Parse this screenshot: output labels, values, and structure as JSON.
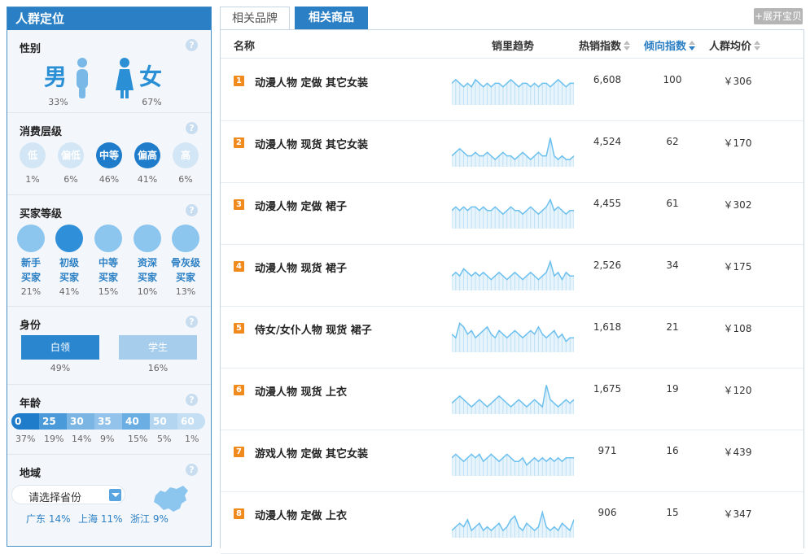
{
  "panel_title": "人群定位",
  "help_glyph": "?",
  "gender": {
    "title": "性别",
    "male_label": "男",
    "male_pct": "33%",
    "female_label": "女",
    "female_pct": "67%"
  },
  "consume": {
    "title": "消费层级",
    "levels": [
      {
        "label": "低",
        "pct": "1%",
        "dark": false
      },
      {
        "label": "偏低",
        "pct": "6%",
        "dark": false
      },
      {
        "label": "中等",
        "pct": "46%",
        "dark": true
      },
      {
        "label": "偏高",
        "pct": "41%",
        "dark": true
      },
      {
        "label": "高",
        "pct": "6%",
        "dark": false
      }
    ]
  },
  "buyer": {
    "title": "买家等级",
    "levels": [
      {
        "line1": "新手",
        "line2": "买家",
        "pct": "21%"
      },
      {
        "line1": "初级",
        "line2": "买家",
        "pct": "41%"
      },
      {
        "line1": "中等",
        "line2": "买家",
        "pct": "15%"
      },
      {
        "line1": "资深",
        "line2": "买家",
        "pct": "10%"
      },
      {
        "line1": "骨灰级",
        "line2": "买家",
        "pct": "13%"
      }
    ]
  },
  "identity": {
    "title": "身份",
    "items": [
      {
        "label": "白领",
        "pct": "49%"
      },
      {
        "label": "学生",
        "pct": "16%"
      }
    ]
  },
  "age": {
    "title": "年龄",
    "bands": [
      {
        "label": "0",
        "pct": "37%",
        "color": "#1e7ccb"
      },
      {
        "label": "25",
        "pct": "19%",
        "color": "#4a9ad9"
      },
      {
        "label": "30",
        "pct": "14%",
        "color": "#7ab5e4"
      },
      {
        "label": "35",
        "pct": "9%",
        "color": "#93c3ea"
      },
      {
        "label": "40",
        "pct": "15%",
        "color": "#6aaee3"
      },
      {
        "label": "50",
        "pct": "5%",
        "color": "#b3d5f0"
      },
      {
        "label": "60",
        "pct": "1%",
        "color": "#c4def3"
      }
    ]
  },
  "region": {
    "title": "地域",
    "select_placeholder": "请选择省份",
    "items": [
      "广东 14%",
      "上海 11%",
      "浙江 9%"
    ]
  },
  "tabs": {
    "brand": "相关品牌",
    "goods": "相关商品",
    "expand": "+展开宝贝"
  },
  "table": {
    "headers": {
      "name": "名称",
      "trend": "销里趋势",
      "hot": "热销指数",
      "tend": "倾向指数",
      "price": "人群均价"
    },
    "rows": [
      {
        "rank": "1",
        "name": "动漫人物 定做 其它女装",
        "hot": "6,608",
        "tend": "100",
        "price": "￥306",
        "trend": [
          6,
          7,
          6,
          5,
          6,
          5,
          7,
          6,
          5,
          6,
          5,
          6,
          6,
          5,
          6,
          7,
          6,
          5,
          6,
          6,
          5,
          6,
          5,
          6,
          6,
          5,
          6,
          7,
          6,
          5,
          6,
          6
        ]
      },
      {
        "rank": "2",
        "name": "动漫人物 现货 其它女装",
        "hot": "4,524",
        "tend": "62",
        "price": "￥170",
        "trend": [
          3,
          4,
          5,
          4,
          3,
          3,
          4,
          3,
          3,
          4,
          3,
          2,
          3,
          4,
          3,
          3,
          2,
          3,
          4,
          3,
          2,
          3,
          4,
          3,
          3,
          8,
          3,
          2,
          3,
          2,
          2,
          3
        ]
      },
      {
        "rank": "3",
        "name": "动漫人物 定做 裙子",
        "hot": "4,455",
        "tend": "61",
        "price": "￥302",
        "trend": [
          5,
          6,
          5,
          6,
          5,
          6,
          6,
          5,
          6,
          5,
          5,
          6,
          5,
          4,
          5,
          6,
          5,
          5,
          4,
          5,
          6,
          5,
          4,
          5,
          6,
          8,
          5,
          6,
          5,
          4,
          5,
          5
        ]
      },
      {
        "rank": "4",
        "name": "动漫人物 现货 裙子",
        "hot": "2,526",
        "tend": "34",
        "price": "￥175",
        "trend": [
          4,
          5,
          4,
          6,
          5,
          4,
          5,
          4,
          5,
          4,
          3,
          4,
          5,
          4,
          3,
          4,
          5,
          4,
          3,
          4,
          5,
          4,
          3,
          4,
          5,
          8,
          4,
          5,
          3,
          5,
          4,
          4
        ]
      },
      {
        "rank": "5",
        "name": "侍女/女仆人物 现货 裙子",
        "hot": "1,618",
        "tend": "21",
        "price": "￥108",
        "trend": [
          5,
          4,
          8,
          7,
          5,
          6,
          4,
          5,
          6,
          7,
          5,
          4,
          6,
          5,
          4,
          5,
          6,
          5,
          4,
          5,
          6,
          5,
          7,
          5,
          4,
          5,
          6,
          4,
          5,
          3,
          4,
          4
        ]
      },
      {
        "rank": "6",
        "name": "动漫人物 现货 上衣",
        "hot": "1,675",
        "tend": "19",
        "price": "￥120",
        "trend": [
          3,
          4,
          5,
          4,
          3,
          2,
          3,
          4,
          3,
          2,
          3,
          4,
          5,
          4,
          3,
          2,
          3,
          4,
          3,
          2,
          3,
          4,
          3,
          2,
          8,
          4,
          3,
          2,
          3,
          4,
          3,
          4
        ]
      },
      {
        "rank": "7",
        "name": "游戏人物 定做 其它女装",
        "hot": "971",
        "tend": "16",
        "price": "￥439",
        "trend": [
          5,
          6,
          5,
          4,
          5,
          6,
          5,
          6,
          4,
          5,
          6,
          5,
          4,
          5,
          6,
          5,
          4,
          4,
          5,
          3,
          4,
          5,
          4,
          5,
          4,
          5,
          4,
          5,
          4,
          5,
          5,
          5
        ]
      },
      {
        "rank": "8",
        "name": "动漫人物 定做 上衣",
        "hot": "906",
        "tend": "15",
        "price": "￥347",
        "trend": [
          2,
          3,
          4,
          3,
          5,
          2,
          3,
          4,
          2,
          3,
          2,
          3,
          4,
          2,
          3,
          5,
          6,
          3,
          2,
          4,
          3,
          2,
          3,
          7,
          3,
          2,
          3,
          2,
          4,
          3,
          2,
          5
        ]
      }
    ]
  },
  "colors": {
    "accent": "#2b7fc4",
    "rank_badge": "#f08a1c",
    "spark_line": "#6cc0ee",
    "spark_fill": "#d7ecfa"
  }
}
